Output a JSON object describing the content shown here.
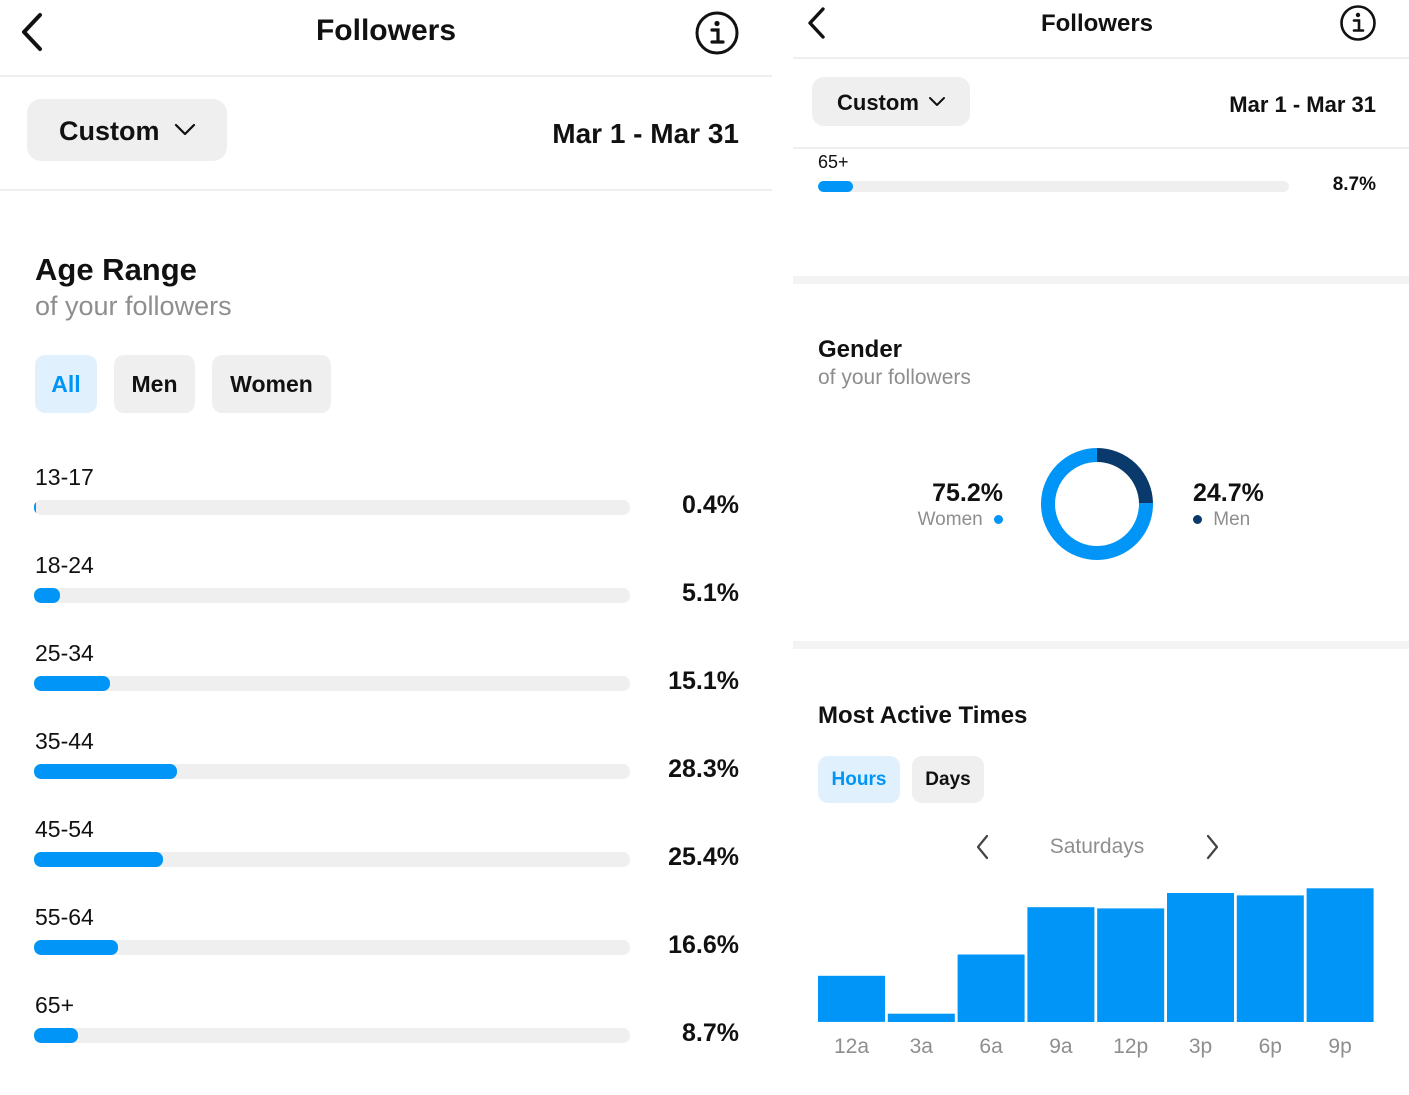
{
  "left": {
    "header": {
      "title": "Followers"
    },
    "filter": {
      "label": "Custom",
      "range": "Mar 1 - Mar 31"
    },
    "age": {
      "title": "Age Range",
      "subtitle": "of your followers",
      "segments": [
        "All",
        "Men",
        "Women"
      ],
      "active_segment": "All",
      "rows": [
        {
          "label": "13-17",
          "value": "0.4%",
          "pct": 0.4
        },
        {
          "label": "18-24",
          "value": "5.1%",
          "pct": 5.1
        },
        {
          "label": "25-34",
          "value": "15.1%",
          "pct": 15.1
        },
        {
          "label": "35-44",
          "value": "28.3%",
          "pct": 28.3
        },
        {
          "label": "45-54",
          "value": "25.4%",
          "pct": 25.4
        },
        {
          "label": "55-64",
          "value": "16.6%",
          "pct": 16.6
        },
        {
          "label": "65+",
          "value": "8.7%",
          "pct": 8.7
        }
      ]
    }
  },
  "right": {
    "header": {
      "title": "Followers"
    },
    "filter": {
      "label": "Custom",
      "range": "Mar 1 - Mar 31"
    },
    "age_partial": {
      "label": "65+",
      "value": "8.7%",
      "pct": 8.7
    },
    "gender": {
      "title": "Gender",
      "subtitle": "of your followers",
      "women_value": "75.2%",
      "women_label": "Women",
      "men_value": "24.7%",
      "men_label": "Men",
      "women_pct": 75.2,
      "men_pct": 24.7
    },
    "active": {
      "title": "Most Active Times",
      "toggle": [
        "Hours",
        "Days"
      ],
      "active_toggle": "Hours",
      "day": "Saturdays"
    }
  },
  "colors": {
    "accent": "#0095f6",
    "men": "#0a3a6b",
    "active_bg": "#e0f1fd",
    "muted": "#8e8e8e"
  },
  "chart_data": {
    "type": "bar",
    "categories": [
      "12a",
      "3a",
      "6a",
      "9a",
      "12p",
      "3p",
      "6p",
      "9p"
    ],
    "values": [
      39,
      7,
      57,
      97,
      96,
      109,
      107,
      113
    ],
    "ylim": [
      0,
      120
    ],
    "grid": false
  }
}
